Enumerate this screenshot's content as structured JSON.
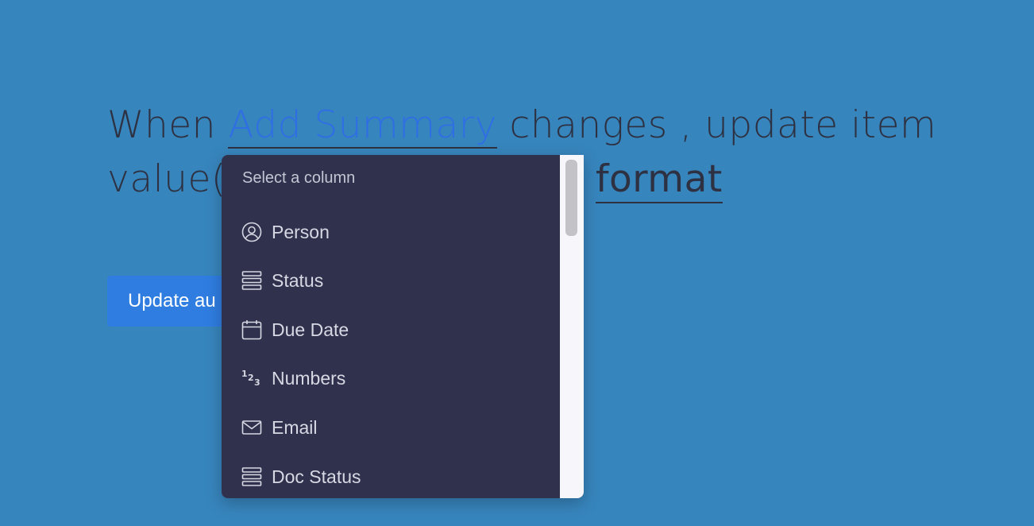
{
  "sentence": {
    "when": "When",
    "field": "Add Summary",
    "rest1": "changes , update item",
    "value_prefix": "value(",
    "format": "format"
  },
  "button": {
    "label": "Update au"
  },
  "dropdown": {
    "header": "Select a column",
    "options": [
      {
        "label": "Person",
        "icon": "person-icon"
      },
      {
        "label": "Status",
        "icon": "status-icon"
      },
      {
        "label": "Due Date",
        "icon": "calendar-icon"
      },
      {
        "label": "Numbers",
        "icon": "numbers-icon"
      },
      {
        "label": "Email",
        "icon": "email-icon"
      },
      {
        "label": "Doc Status",
        "icon": "status-icon"
      }
    ]
  },
  "colors": {
    "background": "#3785bd",
    "accent": "#2f7de1",
    "link": "#2f6ee3",
    "dropdown_bg": "#30324d",
    "text_dark": "#2d3142"
  }
}
